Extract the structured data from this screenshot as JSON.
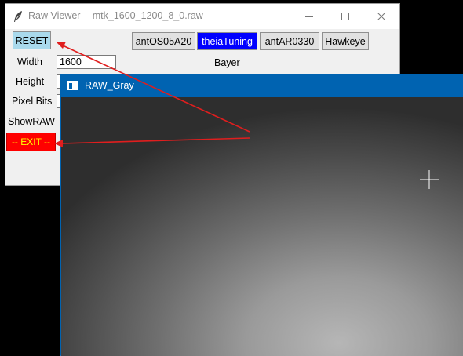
{
  "main_window": {
    "title": "Raw Viewer -- mtk_1600_1200_8_0.raw",
    "buttons": {
      "reset": "RESET",
      "exit": "-- EXIT --",
      "sensors": [
        "antOS05A20",
        "theiaTuning",
        "antAR0330",
        "Hawkeye"
      ]
    },
    "bayer_label": "Bayer",
    "fields": {
      "width_label": "Width",
      "width_value": "1600",
      "height_label": "Height",
      "height_value": "",
      "pixel_bits_label": "Pixel Bits",
      "pixel_bits_value": "",
      "show_raw_label": "ShowRAW"
    },
    "colors": {
      "reset_bg": "#a9d9ec",
      "selected_sensor_bg": "#0000ff",
      "exit_bg": "#ff0000",
      "exit_fg": "#ffff00"
    },
    "icons": [
      "feather-icon",
      "minimize-icon",
      "maximize-icon",
      "close-icon"
    ]
  },
  "raw_window": {
    "title": "RAW_Gray",
    "titlebar_color": "#0063b1",
    "icons": [
      "window-app-icon",
      "crosshair-cursor-icon"
    ]
  },
  "annotations": {
    "arrow_color": "#e01e1e",
    "arrows": [
      "points-to-reset-button",
      "points-to-exit-button"
    ]
  }
}
